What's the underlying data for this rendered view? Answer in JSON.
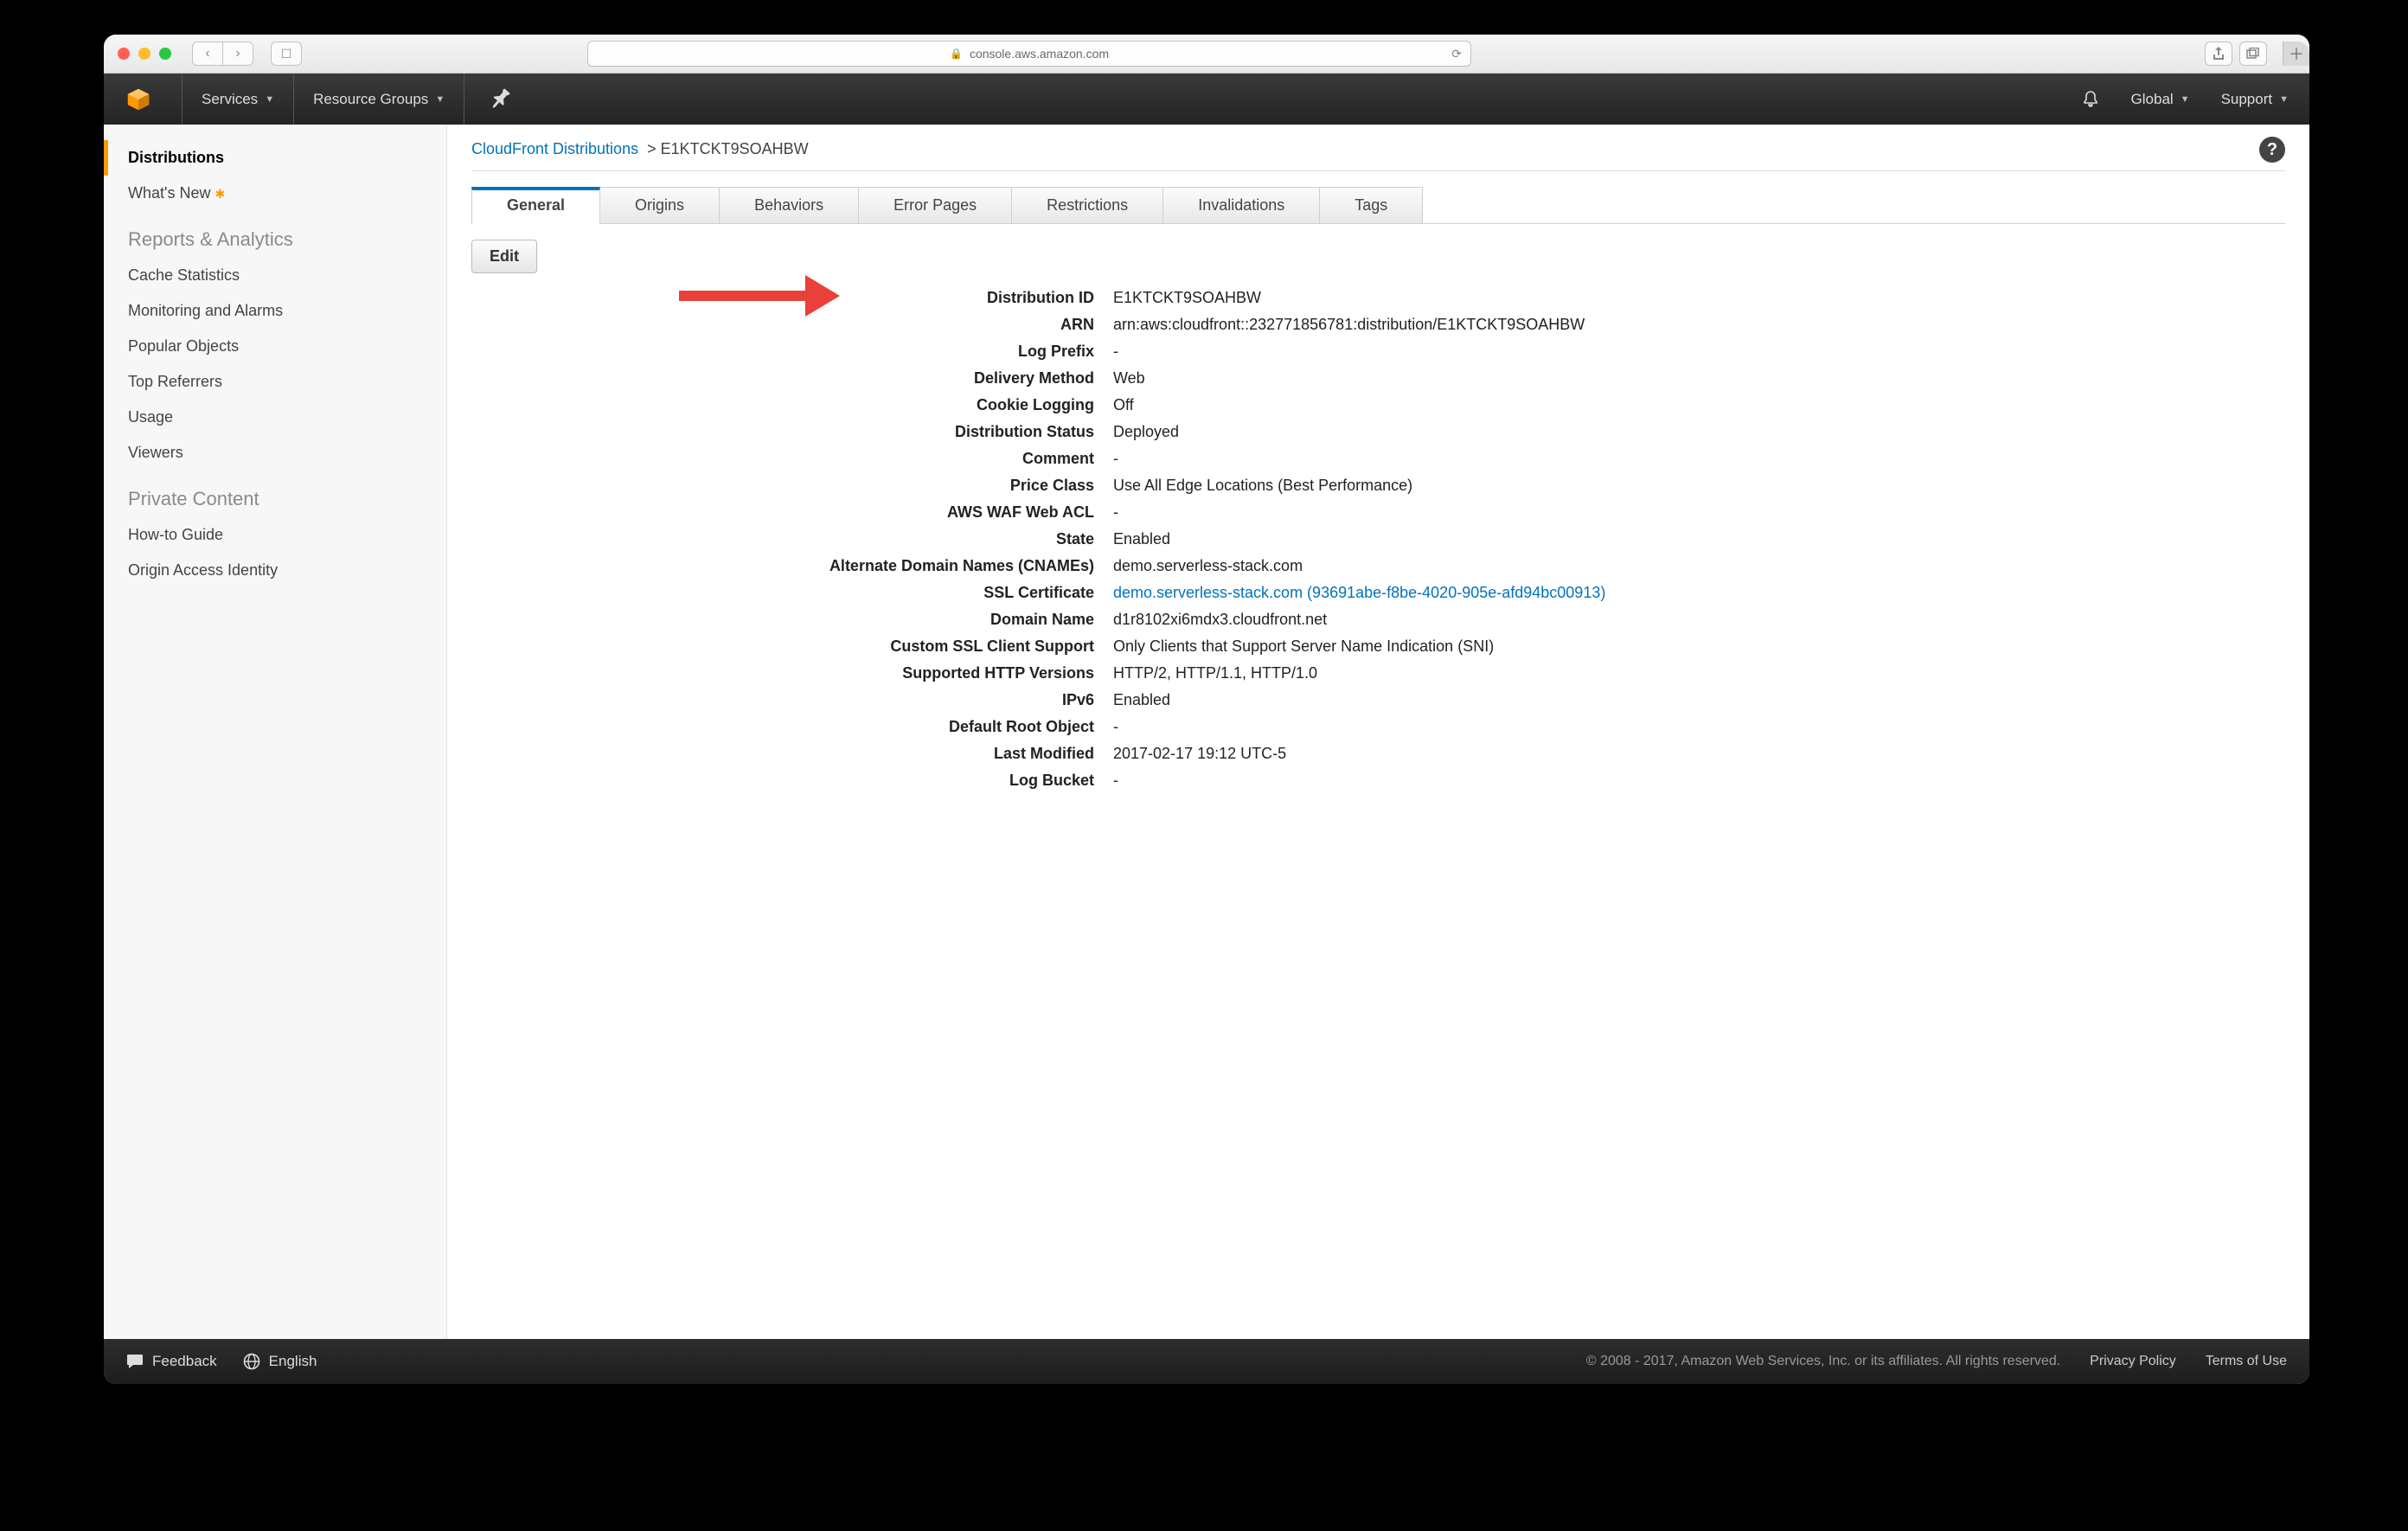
{
  "browser": {
    "url": "console.aws.amazon.com"
  },
  "topnav": {
    "services": "Services",
    "resource_groups": "Resource Groups",
    "region": "Global",
    "support": "Support"
  },
  "sidebar": {
    "items": [
      "Distributions",
      "What's New"
    ],
    "reports_header": "Reports & Analytics",
    "reports": [
      "Cache Statistics",
      "Monitoring and Alarms",
      "Popular Objects",
      "Top Referrers",
      "Usage",
      "Viewers"
    ],
    "private_header": "Private Content",
    "private": [
      "How-to Guide",
      "Origin Access Identity"
    ]
  },
  "breadcrumb": {
    "root": "CloudFront Distributions",
    "id": "E1KTCKT9SOAHBW"
  },
  "tabs": [
    "General",
    "Origins",
    "Behaviors",
    "Error Pages",
    "Restrictions",
    "Invalidations",
    "Tags"
  ],
  "edit_label": "Edit",
  "details": {
    "Distribution ID": "E1KTCKT9SOAHBW",
    "ARN": "arn:aws:cloudfront::232771856781:distribution/E1KTCKT9SOAHBW",
    "Log Prefix": "-",
    "Delivery Method": "Web",
    "Cookie Logging": "Off",
    "Distribution Status": "Deployed",
    "Comment": "-",
    "Price Class": "Use All Edge Locations (Best Performance)",
    "AWS WAF Web ACL": "-",
    "State": "Enabled",
    "Alternate Domain Names (CNAMEs)": "demo.serverless-stack.com",
    "SSL Certificate": "demo.serverless-stack.com (93691abe-f8be-4020-905e-afd94bc00913)",
    "Domain Name": "d1r8102xi6mdx3.cloudfront.net",
    "Custom SSL Client Support": "Only Clients that Support Server Name Indication (SNI)",
    "Supported HTTP Versions": "HTTP/2, HTTP/1.1, HTTP/1.0",
    "IPv6": "Enabled",
    "Default Root Object": "-",
    "Last Modified": "2017-02-17 19:12 UTC-5",
    "Log Bucket": "-"
  },
  "footer": {
    "feedback": "Feedback",
    "language": "English",
    "copyright": "© 2008 - 2017, Amazon Web Services, Inc. or its affiliates. All rights reserved.",
    "privacy": "Privacy Policy",
    "terms": "Terms of Use"
  }
}
